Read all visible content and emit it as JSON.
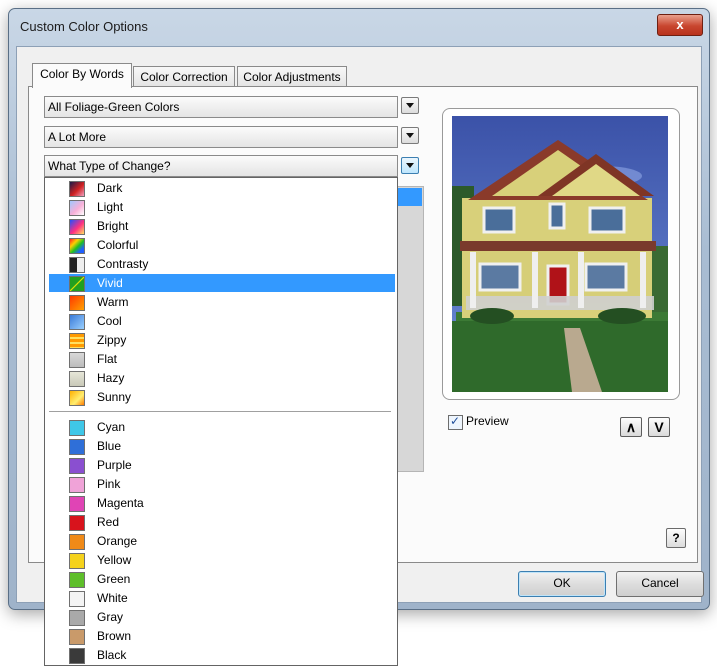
{
  "window": {
    "title": "Custom Color Options",
    "close_glyph": "x"
  },
  "tabs": [
    {
      "label": "Color By Words",
      "active": true
    },
    {
      "label": "Color Correction",
      "active": false
    },
    {
      "label": "Color Adjustments",
      "active": false
    }
  ],
  "combos": {
    "category": {
      "value": "All Foliage-Green Colors"
    },
    "amount": {
      "value": "A Lot More"
    },
    "change_type": {
      "value": "What Type of Change?"
    }
  },
  "dropdown": {
    "selected": "Vivid",
    "group1": [
      {
        "label": "Dark",
        "swatch": "dark-gradient-icon"
      },
      {
        "label": "Light",
        "swatch": "light-gradient-icon"
      },
      {
        "label": "Bright",
        "swatch": "bright-gradient-icon"
      },
      {
        "label": "Colorful",
        "swatch": "colorful-icon"
      },
      {
        "label": "Contrasty",
        "swatch": "contrast-checker-icon"
      },
      {
        "label": "Vivid",
        "swatch": "vivid-icon"
      },
      {
        "label": "Warm",
        "swatch": "warm-icon"
      },
      {
        "label": "Cool",
        "swatch": "cool-icon"
      },
      {
        "label": "Zippy",
        "swatch": "zippy-icon"
      },
      {
        "label": "Flat",
        "swatch": "flat-icon"
      },
      {
        "label": "Hazy",
        "swatch": "hazy-icon"
      },
      {
        "label": "Sunny",
        "swatch": "sunny-icon"
      }
    ],
    "group2": [
      {
        "label": "Cyan",
        "color": "#3fc7e8"
      },
      {
        "label": "Blue",
        "color": "#2f6fd8"
      },
      {
        "label": "Purple",
        "color": "#8a4fd0"
      },
      {
        "label": "Pink",
        "color": "#f0a3d8"
      },
      {
        "label": "Magenta",
        "color": "#e044b5"
      },
      {
        "label": "Red",
        "color": "#d8131c"
      },
      {
        "label": "Orange",
        "color": "#f08a18"
      },
      {
        "label": "Yellow",
        "color": "#f5d21c"
      },
      {
        "label": "Green",
        "color": "#5ebf2a"
      },
      {
        "label": "White",
        "color": "#f4f4f4"
      },
      {
        "label": "Gray",
        "color": "#a9a9a9"
      },
      {
        "label": "Brown",
        "color": "#c99a6a"
      },
      {
        "label": "Black",
        "color": "#3a3a3a"
      }
    ]
  },
  "preview": {
    "checkbox_label": "Preview",
    "checked": true,
    "up_glyph": "∧",
    "down_glyph": "V",
    "image_icon": "house-photo"
  },
  "buttons": {
    "ok": "OK",
    "cancel": "Cancel",
    "help": "?"
  },
  "colors": {
    "selection": "#3399ff",
    "close_button": "#c8462f"
  }
}
